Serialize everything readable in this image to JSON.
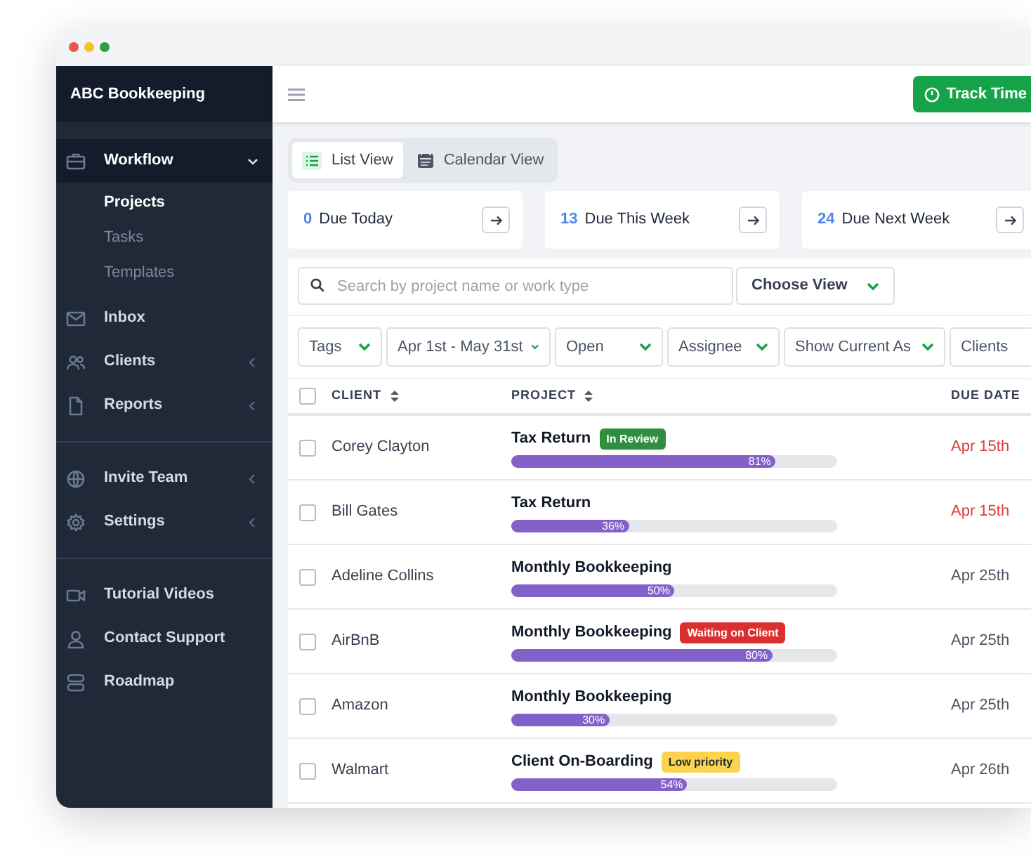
{
  "app_name": "ABC Bookkeeping",
  "sidebar": {
    "groups": [
      {
        "items": [
          {
            "label": "Workflow",
            "selected": true,
            "expanded": true,
            "children": [
              {
                "label": "Projects",
                "selected": true
              },
              {
                "label": "Tasks",
                "selected": false
              },
              {
                "label": "Templates",
                "selected": false
              }
            ]
          },
          {
            "label": "Inbox",
            "selected": false
          },
          {
            "label": "Clients",
            "selected": false,
            "expanded": false
          },
          {
            "label": "Reports",
            "selected": false,
            "expanded": false
          }
        ]
      },
      {
        "items": [
          {
            "label": "Invite Team",
            "selected": false,
            "expanded": false
          },
          {
            "label": "Settings",
            "selected": false,
            "expanded": false
          }
        ]
      },
      {
        "items": [
          {
            "label": "Tutorial Videos",
            "selected": false
          },
          {
            "label": "Contact Support",
            "selected": false
          },
          {
            "label": "Roadmap",
            "selected": false
          }
        ]
      }
    ]
  },
  "header": {
    "button": "Track Time"
  },
  "view_tabs": [
    {
      "label": "List View",
      "selected": true
    },
    {
      "label": "Calendar View",
      "selected": false
    }
  ],
  "summary_cards": [
    {
      "count": "0",
      "label": "Due Today"
    },
    {
      "count": "13",
      "label": "Due This Week"
    },
    {
      "count": "24",
      "label": "Due Next Week"
    }
  ],
  "search": {
    "placeholder": "Search by project name or work type"
  },
  "view_select": "Choose View",
  "filters": [
    "Tags",
    "Apr 1st - May 31st",
    "Open",
    "Assignee",
    "Show Current As",
    "Clients"
  ],
  "table": {
    "select_all_checked": false,
    "columns": [
      "CLIENT",
      "PROJECT",
      "DUE DATE"
    ],
    "rows": [
      {
        "checked": false,
        "client": "Corey Clayton",
        "project": {
          "name": "Tax Return",
          "tag": {
            "label": "In Review",
            "color": "#2f8f3e"
          },
          "level": 0.81,
          "percent": "81%"
        },
        "due": "Apr 15th",
        "overdue": true
      },
      {
        "checked": false,
        "client": "Bill Gates",
        "project": {
          "name": "Tax Return",
          "level": 0.36,
          "percent": "36%"
        },
        "due": "Apr 15th",
        "overdue": true
      },
      {
        "checked": false,
        "client": "Adeline Collins",
        "project": {
          "name": "Monthly Bookkeeping",
          "level": 0.5,
          "percent": "50%"
        },
        "due": "Apr 25th",
        "overdue": false
      },
      {
        "checked": false,
        "client": "AirBnB",
        "project": {
          "name": "Monthly Bookkeeping",
          "tag": {
            "label": "Waiting on Client",
            "color": "#dc2f2f"
          },
          "level": 0.8,
          "percent": "80%"
        },
        "due": "Apr 25th",
        "overdue": false
      },
      {
        "checked": false,
        "client": "Amazon",
        "project": {
          "name": "Monthly Bookkeeping",
          "level": 0.3,
          "percent": "30%"
        },
        "due": "Apr 25th",
        "overdue": false
      },
      {
        "checked": false,
        "client": "Walmart",
        "project": {
          "name": "Client On-Boarding",
          "tag": {
            "label": "Low priority",
            "color": "#fcd34d"
          },
          "level": 0.54,
          "percent": "54%"
        },
        "due": "Apr 26th",
        "overdue": false
      }
    ]
  }
}
